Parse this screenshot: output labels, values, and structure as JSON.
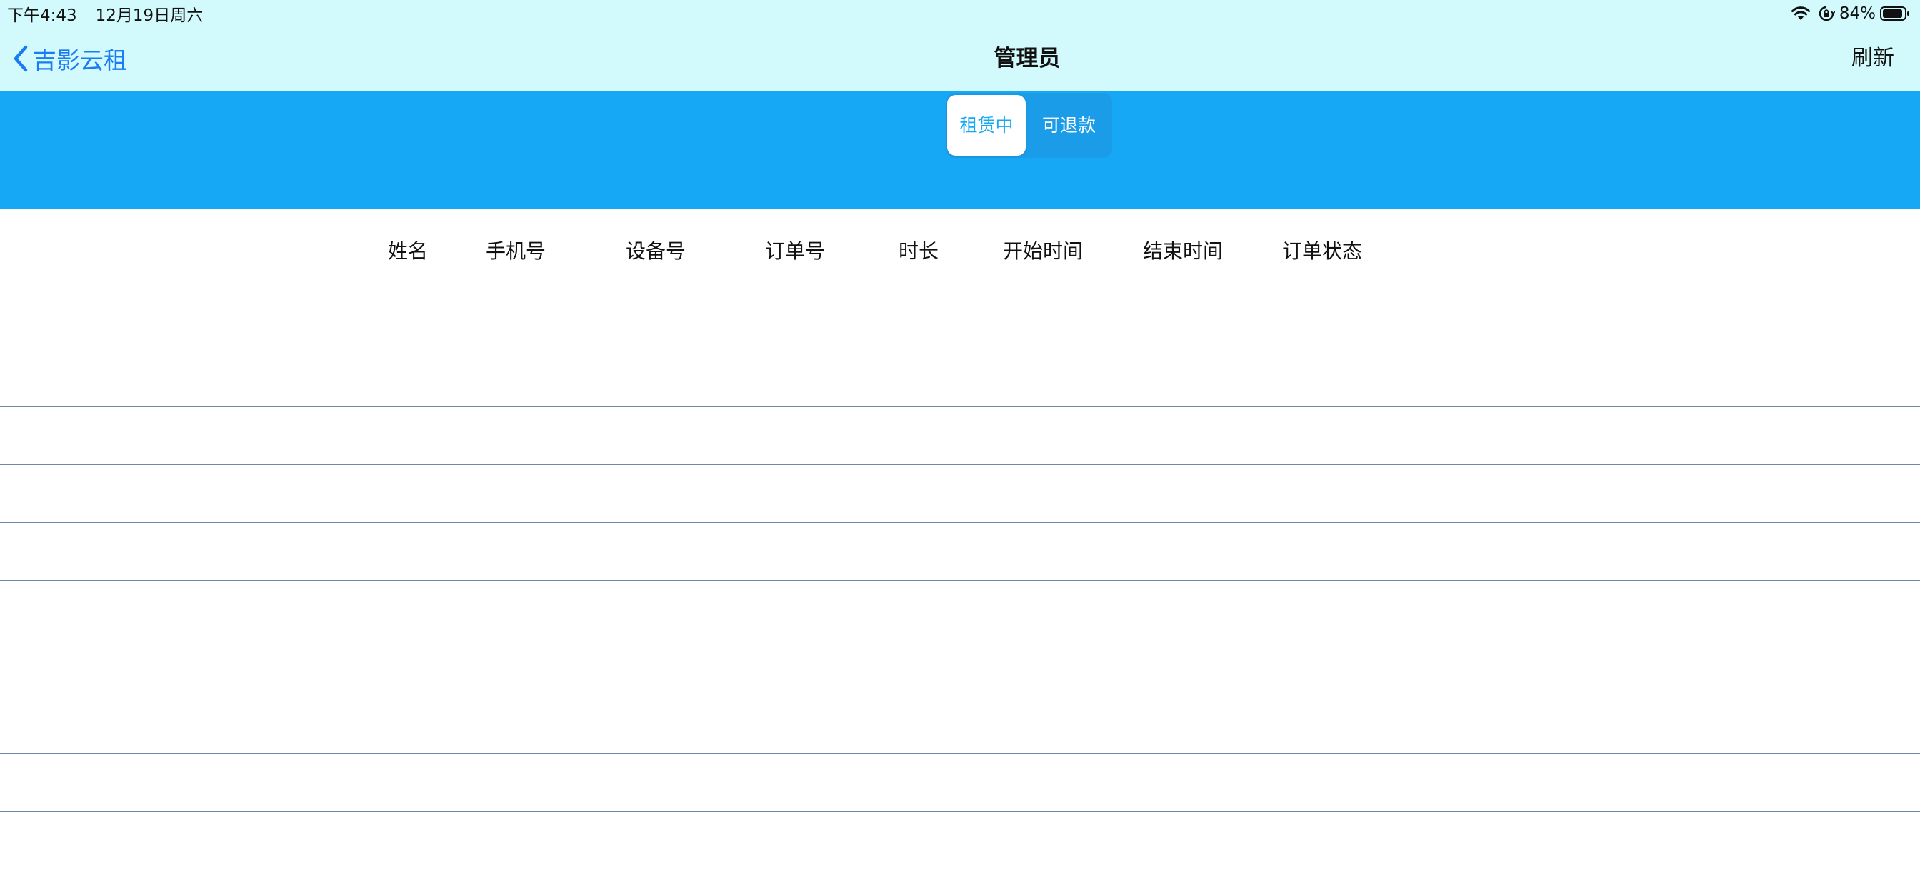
{
  "status_bar": {
    "time": "下午4:43",
    "date": "12月19日周六",
    "battery": "84%",
    "icons": [
      "wifi-icon",
      "orientation-lock-icon",
      "battery-icon"
    ]
  },
  "nav": {
    "back_label": "吉影云租",
    "title": "管理员",
    "refresh_label": "刷新"
  },
  "segmented": {
    "options": [
      "租赁中",
      "可退款"
    ],
    "selected": "租赁中"
  },
  "table": {
    "columns": [
      "姓名",
      "手机号",
      "设备号",
      "订单号",
      "时长",
      "开始时间",
      "结束时间",
      "订单状态"
    ],
    "rows": []
  },
  "colors": {
    "header_bg": "#d2fafd",
    "band_bg": "#17a8f5",
    "accent": "#1a7cf5",
    "divider": "#6f86a8"
  }
}
